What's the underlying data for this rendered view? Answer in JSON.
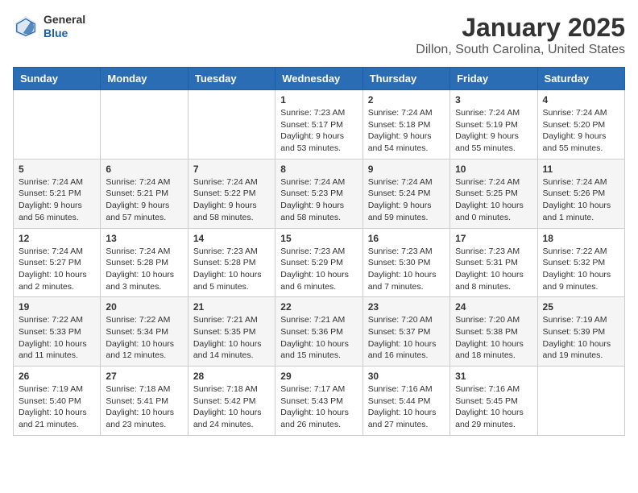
{
  "header": {
    "logo_general": "General",
    "logo_blue": "Blue",
    "month_title": "January 2025",
    "location": "Dillon, South Carolina, United States"
  },
  "weekdays": [
    "Sunday",
    "Monday",
    "Tuesday",
    "Wednesday",
    "Thursday",
    "Friday",
    "Saturday"
  ],
  "weeks": [
    [
      {
        "day": "",
        "info": ""
      },
      {
        "day": "",
        "info": ""
      },
      {
        "day": "",
        "info": ""
      },
      {
        "day": "1",
        "info": "Sunrise: 7:23 AM\nSunset: 5:17 PM\nDaylight: 9 hours\nand 53 minutes."
      },
      {
        "day": "2",
        "info": "Sunrise: 7:24 AM\nSunset: 5:18 PM\nDaylight: 9 hours\nand 54 minutes."
      },
      {
        "day": "3",
        "info": "Sunrise: 7:24 AM\nSunset: 5:19 PM\nDaylight: 9 hours\nand 55 minutes."
      },
      {
        "day": "4",
        "info": "Sunrise: 7:24 AM\nSunset: 5:20 PM\nDaylight: 9 hours\nand 55 minutes."
      }
    ],
    [
      {
        "day": "5",
        "info": "Sunrise: 7:24 AM\nSunset: 5:21 PM\nDaylight: 9 hours\nand 56 minutes."
      },
      {
        "day": "6",
        "info": "Sunrise: 7:24 AM\nSunset: 5:21 PM\nDaylight: 9 hours\nand 57 minutes."
      },
      {
        "day": "7",
        "info": "Sunrise: 7:24 AM\nSunset: 5:22 PM\nDaylight: 9 hours\nand 58 minutes."
      },
      {
        "day": "8",
        "info": "Sunrise: 7:24 AM\nSunset: 5:23 PM\nDaylight: 9 hours\nand 58 minutes."
      },
      {
        "day": "9",
        "info": "Sunrise: 7:24 AM\nSunset: 5:24 PM\nDaylight: 9 hours\nand 59 minutes."
      },
      {
        "day": "10",
        "info": "Sunrise: 7:24 AM\nSunset: 5:25 PM\nDaylight: 10 hours\nand 0 minutes."
      },
      {
        "day": "11",
        "info": "Sunrise: 7:24 AM\nSunset: 5:26 PM\nDaylight: 10 hours\nand 1 minute."
      }
    ],
    [
      {
        "day": "12",
        "info": "Sunrise: 7:24 AM\nSunset: 5:27 PM\nDaylight: 10 hours\nand 2 minutes."
      },
      {
        "day": "13",
        "info": "Sunrise: 7:24 AM\nSunset: 5:28 PM\nDaylight: 10 hours\nand 3 minutes."
      },
      {
        "day": "14",
        "info": "Sunrise: 7:23 AM\nSunset: 5:28 PM\nDaylight: 10 hours\nand 5 minutes."
      },
      {
        "day": "15",
        "info": "Sunrise: 7:23 AM\nSunset: 5:29 PM\nDaylight: 10 hours\nand 6 minutes."
      },
      {
        "day": "16",
        "info": "Sunrise: 7:23 AM\nSunset: 5:30 PM\nDaylight: 10 hours\nand 7 minutes."
      },
      {
        "day": "17",
        "info": "Sunrise: 7:23 AM\nSunset: 5:31 PM\nDaylight: 10 hours\nand 8 minutes."
      },
      {
        "day": "18",
        "info": "Sunrise: 7:22 AM\nSunset: 5:32 PM\nDaylight: 10 hours\nand 9 minutes."
      }
    ],
    [
      {
        "day": "19",
        "info": "Sunrise: 7:22 AM\nSunset: 5:33 PM\nDaylight: 10 hours\nand 11 minutes."
      },
      {
        "day": "20",
        "info": "Sunrise: 7:22 AM\nSunset: 5:34 PM\nDaylight: 10 hours\nand 12 minutes."
      },
      {
        "day": "21",
        "info": "Sunrise: 7:21 AM\nSunset: 5:35 PM\nDaylight: 10 hours\nand 14 minutes."
      },
      {
        "day": "22",
        "info": "Sunrise: 7:21 AM\nSunset: 5:36 PM\nDaylight: 10 hours\nand 15 minutes."
      },
      {
        "day": "23",
        "info": "Sunrise: 7:20 AM\nSunset: 5:37 PM\nDaylight: 10 hours\nand 16 minutes."
      },
      {
        "day": "24",
        "info": "Sunrise: 7:20 AM\nSunset: 5:38 PM\nDaylight: 10 hours\nand 18 minutes."
      },
      {
        "day": "25",
        "info": "Sunrise: 7:19 AM\nSunset: 5:39 PM\nDaylight: 10 hours\nand 19 minutes."
      }
    ],
    [
      {
        "day": "26",
        "info": "Sunrise: 7:19 AM\nSunset: 5:40 PM\nDaylight: 10 hours\nand 21 minutes."
      },
      {
        "day": "27",
        "info": "Sunrise: 7:18 AM\nSunset: 5:41 PM\nDaylight: 10 hours\nand 23 minutes."
      },
      {
        "day": "28",
        "info": "Sunrise: 7:18 AM\nSunset: 5:42 PM\nDaylight: 10 hours\nand 24 minutes."
      },
      {
        "day": "29",
        "info": "Sunrise: 7:17 AM\nSunset: 5:43 PM\nDaylight: 10 hours\nand 26 minutes."
      },
      {
        "day": "30",
        "info": "Sunrise: 7:16 AM\nSunset: 5:44 PM\nDaylight: 10 hours\nand 27 minutes."
      },
      {
        "day": "31",
        "info": "Sunrise: 7:16 AM\nSunset: 5:45 PM\nDaylight: 10 hours\nand 29 minutes."
      },
      {
        "day": "",
        "info": ""
      }
    ]
  ]
}
